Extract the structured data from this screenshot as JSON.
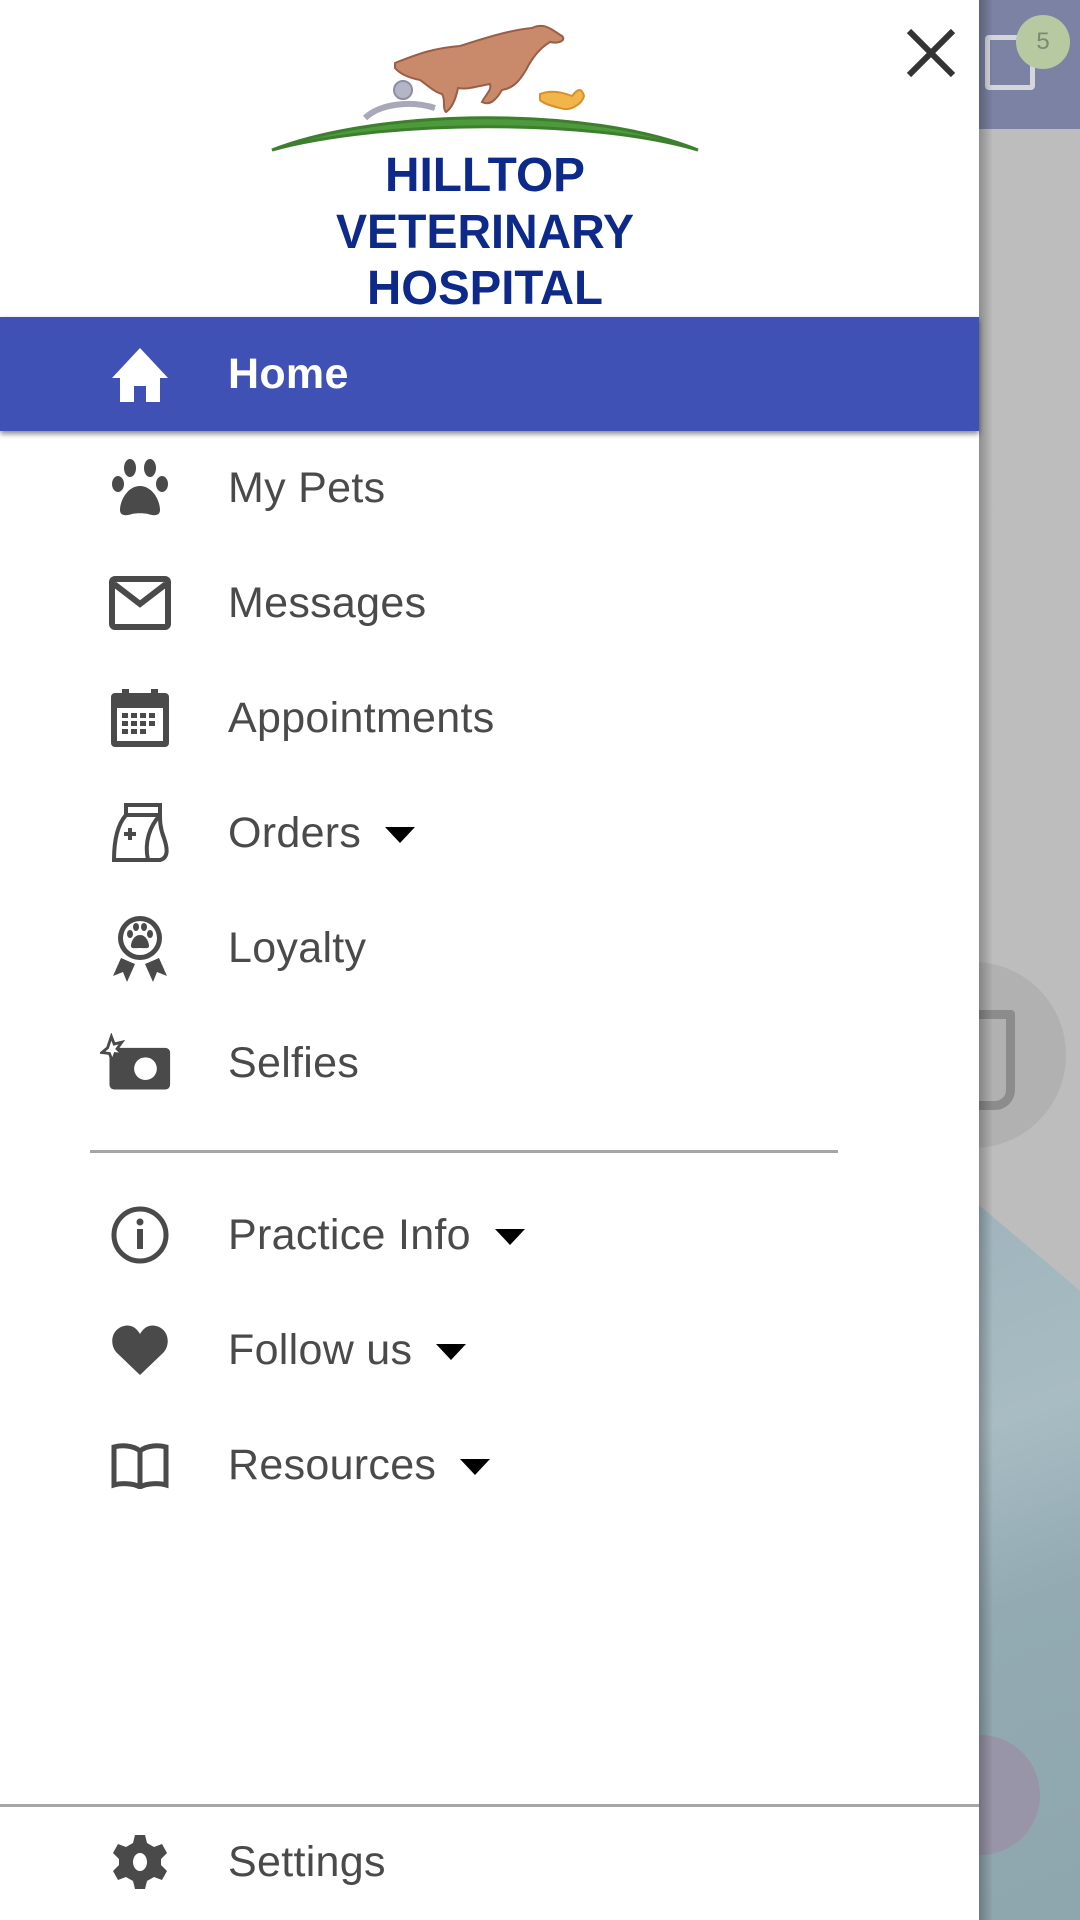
{
  "background_app": {
    "message_badge_count": "5"
  },
  "drawer": {
    "logo": {
      "line1": "HILLTOP",
      "line2": "VETERINARY",
      "line3": "HOSPITAL",
      "brand_color": "#0d2a8a",
      "hill_color": "#4c9a3a",
      "horse_color": "#c98a6b"
    },
    "close_icon": "close-icon",
    "active_color": "#3f51b5",
    "items": [
      {
        "label": "Home",
        "icon": "home-icon",
        "active": true,
        "has_dropdown": false
      },
      {
        "label": "My Pets",
        "icon": "paw-icon",
        "active": false,
        "has_dropdown": false
      },
      {
        "label": "Messages",
        "icon": "envelope-icon",
        "active": false,
        "has_dropdown": false
      },
      {
        "label": "Appointments",
        "icon": "calendar-icon",
        "active": false,
        "has_dropdown": false
      },
      {
        "label": "Orders",
        "icon": "food-bag-icon",
        "active": false,
        "has_dropdown": true
      },
      {
        "label": "Loyalty",
        "icon": "award-ribbon-icon",
        "active": false,
        "has_dropdown": false
      },
      {
        "label": "Selfies",
        "icon": "camera-star-icon",
        "active": false,
        "has_dropdown": false
      }
    ],
    "secondary_items": [
      {
        "label": "Practice Info",
        "icon": "info-icon",
        "has_dropdown": true
      },
      {
        "label": "Follow us",
        "icon": "heart-icon",
        "has_dropdown": true
      },
      {
        "label": "Resources",
        "icon": "book-icon",
        "has_dropdown": true
      }
    ],
    "footer": {
      "settings_label": "Settings",
      "icon": "gear-icon"
    }
  }
}
